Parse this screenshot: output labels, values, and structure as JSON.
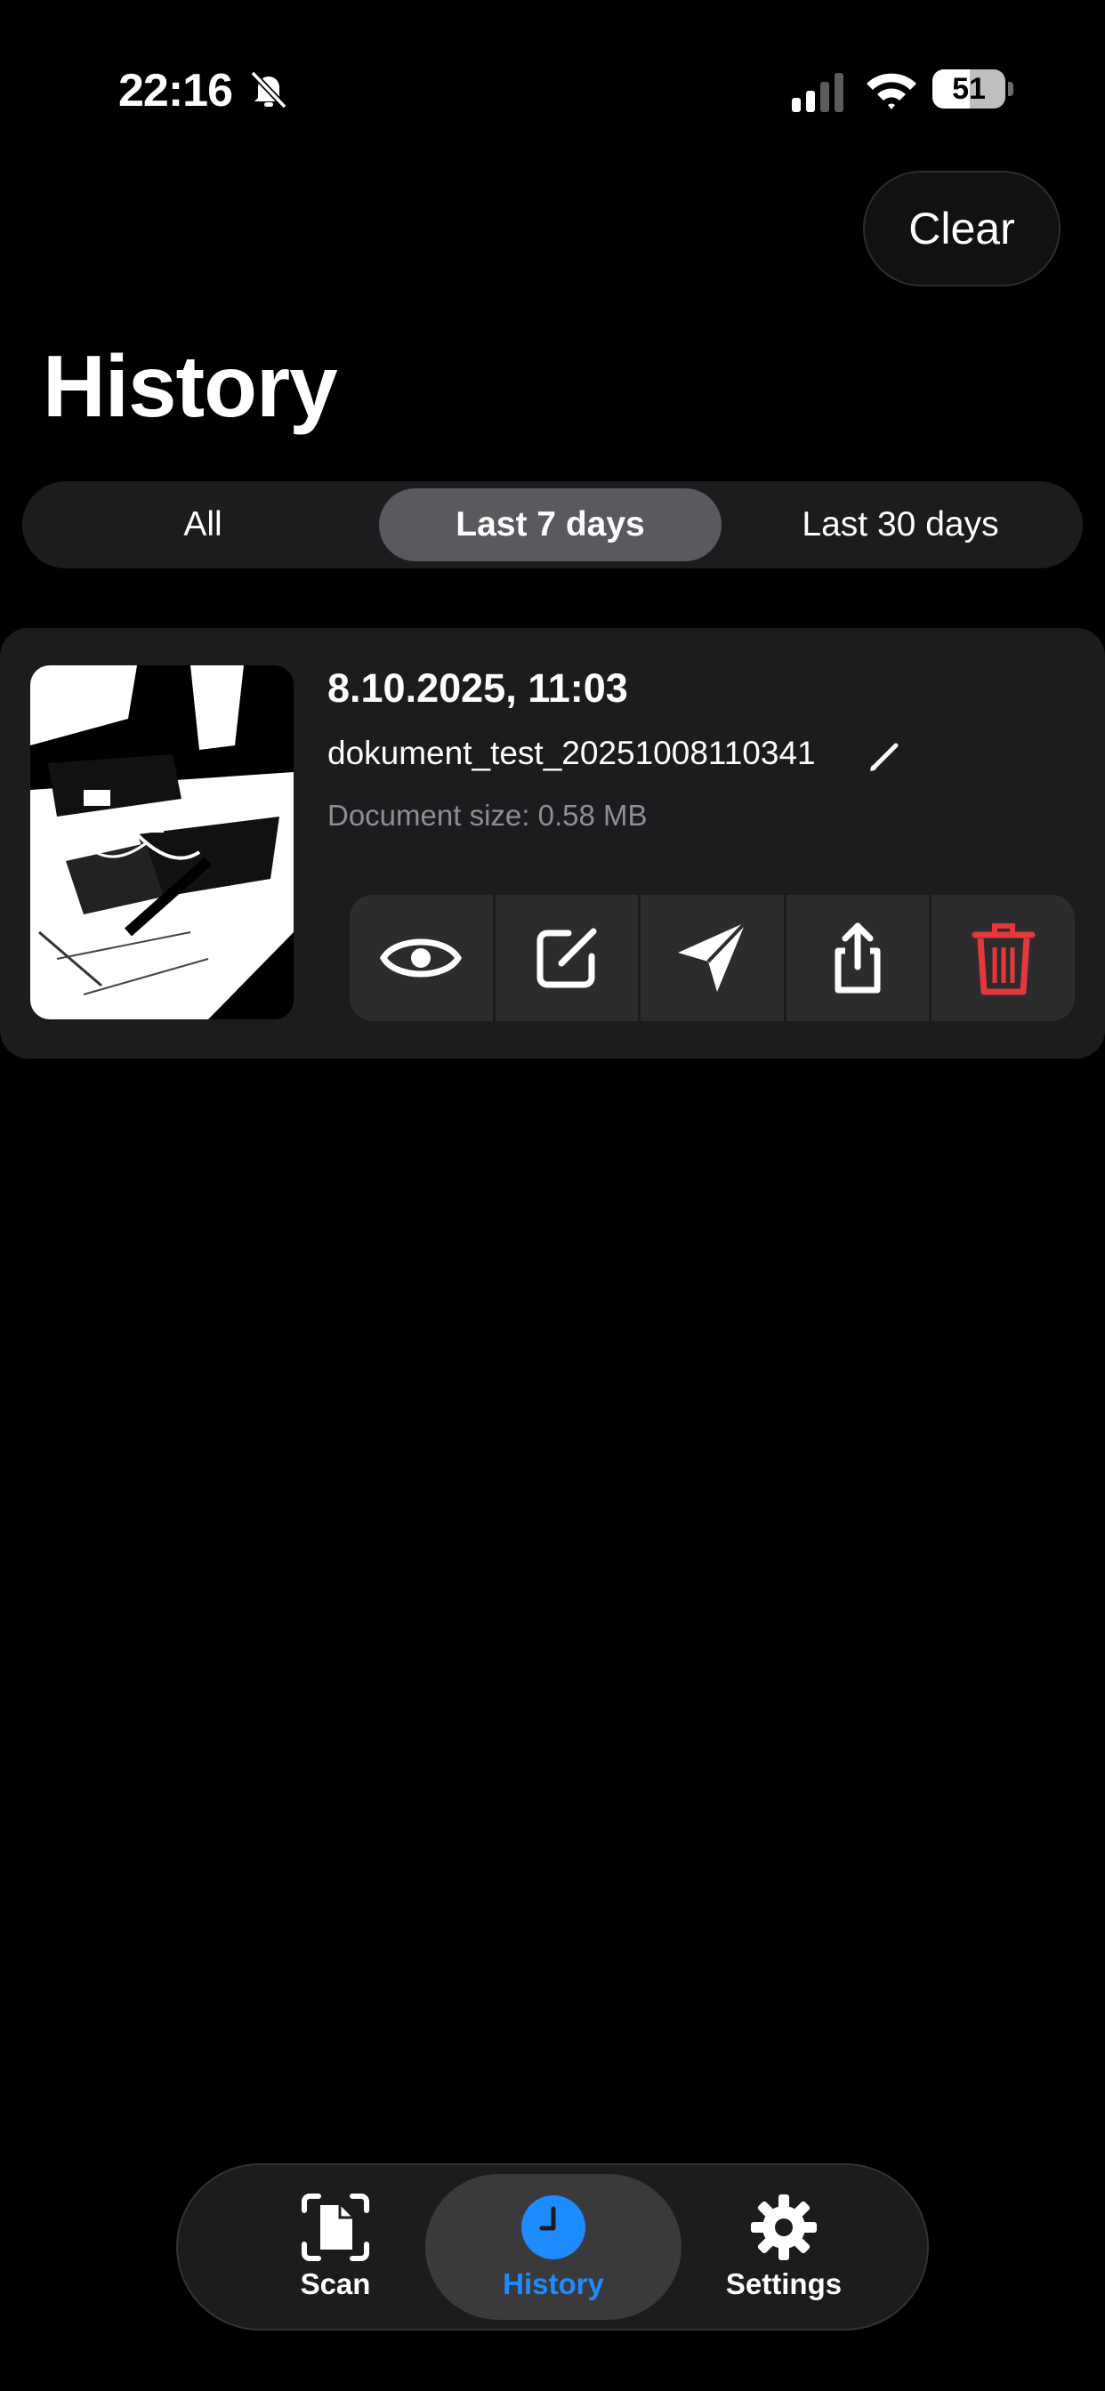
{
  "status_bar": {
    "time": "22:16",
    "battery": "51"
  },
  "header": {
    "clear_label": "Clear",
    "title": "History"
  },
  "filters": {
    "tabs": [
      "All",
      "Last 7 days",
      "Last 30 days"
    ],
    "selected": "Last 7 days"
  },
  "documents": [
    {
      "date": "8.10.2025, 11:03",
      "name": "dokument_test_20251008110341",
      "size": "Document size: 0.58 MB"
    }
  ],
  "tab_bar": {
    "items": [
      {
        "label": "Scan",
        "icon": "scan-document-icon"
      },
      {
        "label": "History",
        "icon": "clock-icon"
      },
      {
        "label": "Settings",
        "icon": "gear-icon"
      }
    ],
    "active": "History",
    "accent": "#1e8bff"
  },
  "colors": {
    "delete": "#e5383b",
    "background": "#000000",
    "card": "#1c1c1e"
  }
}
